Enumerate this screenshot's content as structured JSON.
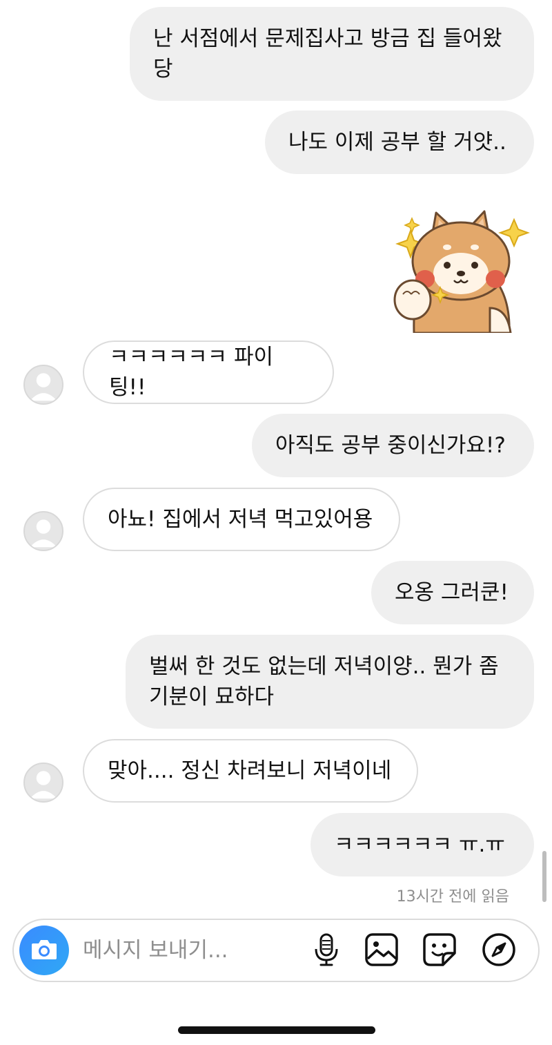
{
  "messages": [
    {
      "from": "me",
      "text": "난 서점에서 문제집사고 방금 집 들어왔당"
    },
    {
      "from": "me",
      "text": "나도 이제 공부 할 거얏.."
    },
    {
      "from": "me",
      "type": "sticker",
      "icon": "shiba-dog-sticker"
    },
    {
      "from": "them",
      "text": "ㅋㅋㅋㅋㅋㅋ 파이팅!!"
    },
    {
      "from": "me",
      "text": "아직도 공부 중이신가요!?"
    },
    {
      "from": "them",
      "text": "아뇨! 집에서 저녁 먹고있어용"
    },
    {
      "from": "me",
      "text": "오옹 그러쿤!"
    },
    {
      "from": "me",
      "text": "벌써 한 것도 없는데 저녁이양.. 뭔가 좀 기분이 묘하다"
    },
    {
      "from": "them",
      "text": "맞아.... 정신 차려보니 저녁이네"
    },
    {
      "from": "me",
      "text": "ㅋㅋㅋㅋㅋㅋ ㅠ.ㅠ"
    }
  ],
  "read_receipt": "13시간 전에 읽음",
  "composer": {
    "placeholder": "메시지 보내기...",
    "icons": [
      "camera-icon",
      "microphone-icon",
      "gallery-icon",
      "sticker-icon",
      "compass-icon"
    ]
  },
  "colors": {
    "my_bubble": "#efefef",
    "their_bubble_border": "#dcdcdc",
    "camera_button": "#3a8bff",
    "meta_text": "#8e8e8e"
  }
}
